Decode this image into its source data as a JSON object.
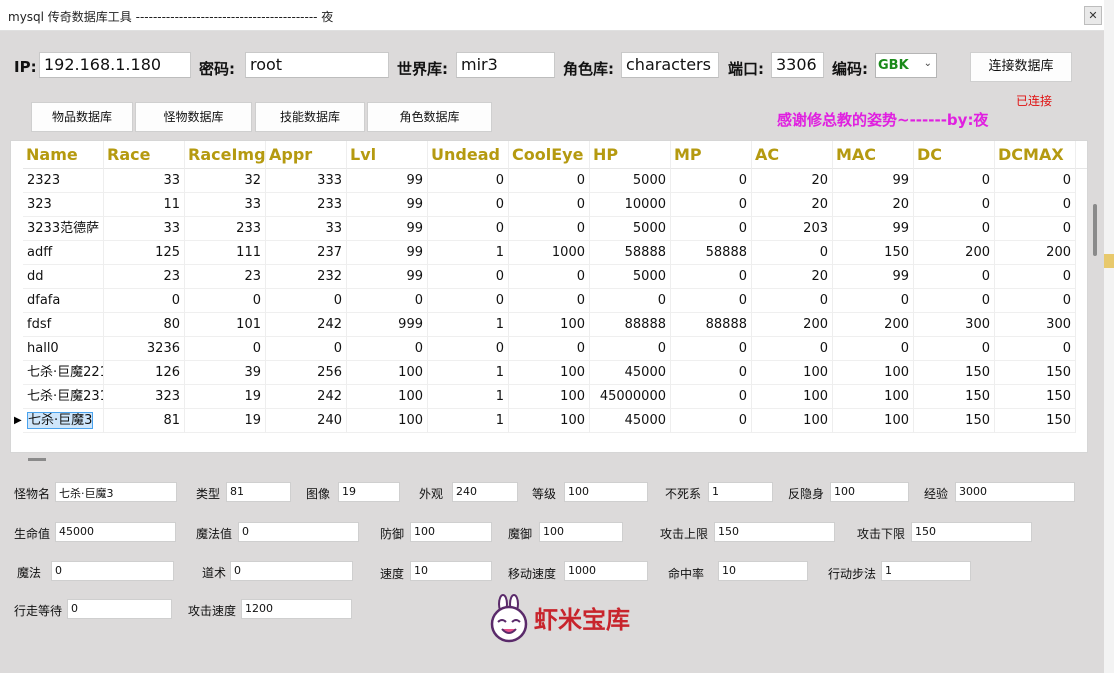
{
  "window": {
    "title": "mysql 传奇数据库工具 ------------------------------------------ 夜",
    "close": "✕"
  },
  "connection": {
    "ip_label": "IP:",
    "ip_value": "192.168.1.180",
    "pwd_label": "密码:",
    "pwd_value": "root",
    "world_label": "世界库:",
    "world_value": "mir3",
    "role_label": "角色库:",
    "role_value": "characters",
    "port_label": "端口:",
    "port_value": "3306",
    "encoding_label": "编码:",
    "encoding_value": "GBK",
    "connect_button": "连接数据库",
    "status": "已连接"
  },
  "tabs": [
    "物品数据库",
    "怪物数据库",
    "技能数据库",
    "角色数据库"
  ],
  "credit": "感谢修总教的姿势~------by:夜",
  "grid": {
    "columns": [
      "Name",
      "Race",
      "RaceImg",
      "Appr",
      "Lvl",
      "Undead",
      "CoolEye",
      "HP",
      "MP",
      "AC",
      "MAC",
      "DC",
      "DCMAX",
      ""
    ],
    "rows": [
      [
        "2323",
        "33",
        "32",
        "333",
        "99",
        "0",
        "0",
        "5000",
        "0",
        "20",
        "99",
        "0",
        "0"
      ],
      [
        "323",
        "11",
        "33",
        "233",
        "99",
        "0",
        "0",
        "10000",
        "0",
        "20",
        "20",
        "0",
        "0"
      ],
      [
        "3233范德萨",
        "33",
        "233",
        "33",
        "99",
        "0",
        "0",
        "5000",
        "0",
        "203",
        "99",
        "0",
        "0"
      ],
      [
        "adff",
        "125",
        "111",
        "237",
        "99",
        "1",
        "1000",
        "58888",
        "58888",
        "0",
        "150",
        "200",
        "200"
      ],
      [
        "dd",
        "23",
        "23",
        "232",
        "99",
        "0",
        "0",
        "5000",
        "0",
        "20",
        "99",
        "0",
        "0"
      ],
      [
        "dfafa",
        "0",
        "0",
        "0",
        "0",
        "0",
        "0",
        "0",
        "0",
        "0",
        "0",
        "0",
        "0"
      ],
      [
        "fdsf",
        "80",
        "101",
        "242",
        "999",
        "1",
        "100",
        "88888",
        "88888",
        "200",
        "200",
        "300",
        "300"
      ],
      [
        "hall0",
        "3236",
        "0",
        "0",
        "0",
        "0",
        "0",
        "0",
        "0",
        "0",
        "0",
        "0",
        "0"
      ],
      [
        "七杀·巨魔221",
        "126",
        "39",
        "256",
        "100",
        "1",
        "100",
        "45000",
        "0",
        "100",
        "100",
        "150",
        "150"
      ],
      [
        "七杀·巨魔231",
        "323",
        "19",
        "242",
        "100",
        "1",
        "100",
        "45000000",
        "0",
        "100",
        "100",
        "150",
        "150"
      ],
      [
        "七杀·巨魔3",
        "81",
        "19",
        "240",
        "100",
        "1",
        "100",
        "45000",
        "0",
        "100",
        "100",
        "150",
        "150"
      ]
    ],
    "selected_row": 10
  },
  "detail": {
    "name_label": "怪物名",
    "name_value": "七杀·巨魔3",
    "type_label": "类型",
    "type_value": "81",
    "image_label": "图像",
    "image_value": "19",
    "appr_label": "外观",
    "appr_value": "240",
    "level_label": "等级",
    "level_value": "100",
    "undead_label": "不死系",
    "undead_value": "1",
    "antihide_label": "反隐身",
    "antihide_value": "100",
    "exp_label": "经验",
    "exp_value": "3000",
    "hp_label": "生命值",
    "hp_value": "45000",
    "mp_label": "魔法值",
    "mp_value": "0",
    "def_label": "防御",
    "def_value": "100",
    "mdef_label": "魔御",
    "mdef_value": "100",
    "atkmax_label": "攻击上限",
    "atkmax_value": "150",
    "atkmin_label": "攻击下限",
    "atkmin_value": "150",
    "magic_label": "魔法",
    "magic_value": "0",
    "tao_label": "道术",
    "tao_value": "0",
    "speed_label": "速度",
    "speed_value": "10",
    "movespeed_label": "移动速度",
    "movespeed_value": "1000",
    "hit_label": "命中率",
    "hit_value": "10",
    "step_label": "行动步法",
    "step_value": "1",
    "walkwait_label": "行走等待",
    "walkwait_value": "0",
    "atkspeed_label": "攻击速度",
    "atkspeed_value": "1200"
  },
  "logo": {
    "icon": "rabbit-logo-icon",
    "text": "虾米宝库"
  }
}
